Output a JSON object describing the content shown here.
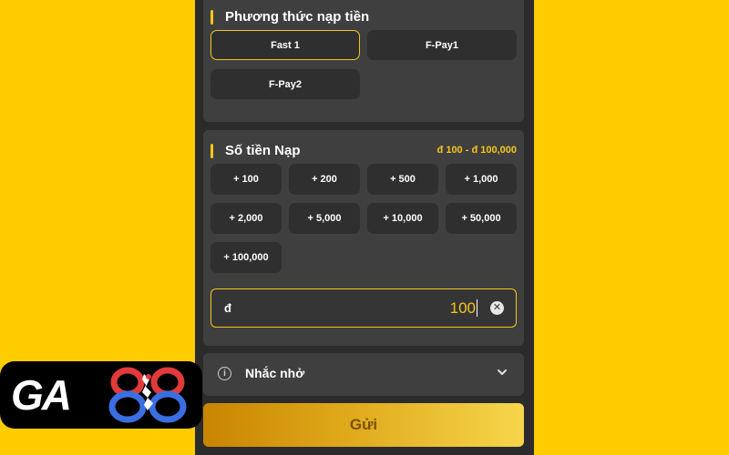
{
  "method": {
    "title": "Phương thức nạp tiền",
    "options": [
      {
        "label": "Fast 1",
        "selected": true
      },
      {
        "label": "F-Pay1",
        "selected": false
      },
      {
        "label": "F-Pay2",
        "selected": false
      }
    ]
  },
  "amount": {
    "title": "Số tiền Nạp",
    "range": "đ 100 - đ 100,000",
    "quick": [
      "+ 100",
      "+ 200",
      "+ 500",
      "+ 1,000",
      "+ 2,000",
      "+ 5,000",
      "+ 10,000",
      "+ 50,000",
      "+ 100,000"
    ],
    "currency": "đ",
    "value": "100"
  },
  "reminder": {
    "label": "Nhắc nhở"
  },
  "submit": {
    "label": "Gửi"
  },
  "logo": {
    "text": "GA88",
    "colors": {
      "red": "#E23A3A",
      "blue": "#3A6FE2"
    }
  },
  "colors": {
    "background": "#FFCC00",
    "accent": "#F5C518"
  }
}
